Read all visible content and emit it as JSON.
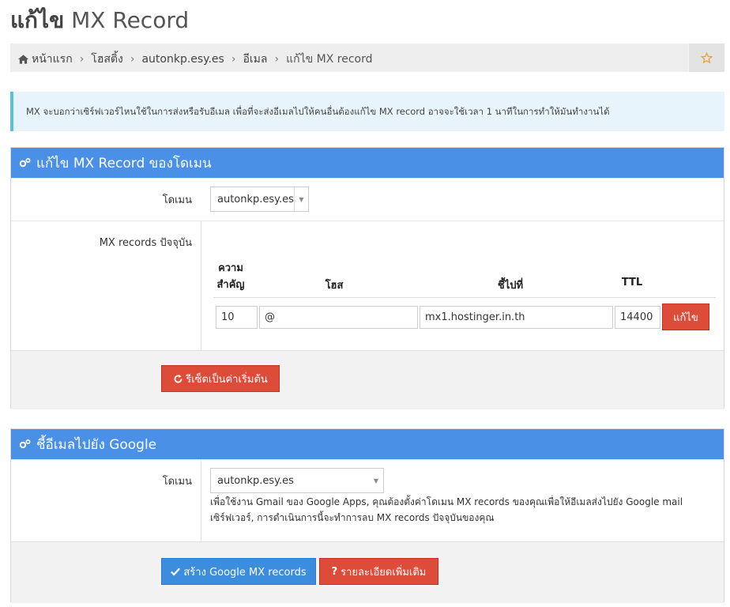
{
  "page": {
    "title_prefix": "แก้ไข",
    "title_rest": " MX Record"
  },
  "breadcrumb": {
    "home": "หน้าแรก",
    "items": [
      "โฮสติ้ง",
      "autonkp.esy.es",
      "อีเมล",
      "แก้ไข MX record"
    ]
  },
  "info": {
    "text": "MX จะบอกว่าเซิร์ฟเวอร์ไหนใช้ในการส่งหรือรับอีเมล เพื่อที่จะส่งอีเมลไปให้คนอื่นต้องแก้ไข MX record อาจจะใช้เวลา 1 นาทีในการทำให้มันทำงานได้"
  },
  "panel_mx": {
    "heading": "แก้ไข MX Record ของโดเมน",
    "domain_label": "โดเมน",
    "domain_value": "autonkp.esy.es",
    "records_label": "MX records ปัจจุบัน",
    "columns": {
      "priority_line1": "ความ",
      "priority_line2": "สำคัญ",
      "host": "โฮส",
      "points_to": "ชี้ไปที่",
      "ttl": "TTL"
    },
    "record": {
      "priority": "10",
      "host": "@",
      "points_to": "mx1.hostinger.in.th",
      "ttl": "14400"
    },
    "edit_button": "แก้ไข",
    "reset_button": "รีเซ็ตเป็นค่าเริ่มต้น"
  },
  "panel_google": {
    "heading": "ชี้อีเมลไปยัง Google",
    "domain_label": "โดเมน",
    "domain_value": "autonkp.esy.es",
    "help_line1": "เพื่อใช้งาน Gmail ของ Google Apps, คุณต้องตั้งค่าโดเมน MX records ของคุณเพื่อให้อีเมลส่งไปยัง Google mail",
    "help_line2": "เซิร์ฟเวอร์, การดำเนินการนี้จะทำการลบ MX records ปัจจุบันของคุณ",
    "create_button": "สร้าง Google MX records",
    "details_button": "รายละเอียดเพิ่มเติม"
  },
  "colors": {
    "panel_heading": "#4a90e6",
    "danger": "#dd4b39",
    "primary": "#3c8dde",
    "info_border": "#5bc0de",
    "star": "#f0a030"
  }
}
